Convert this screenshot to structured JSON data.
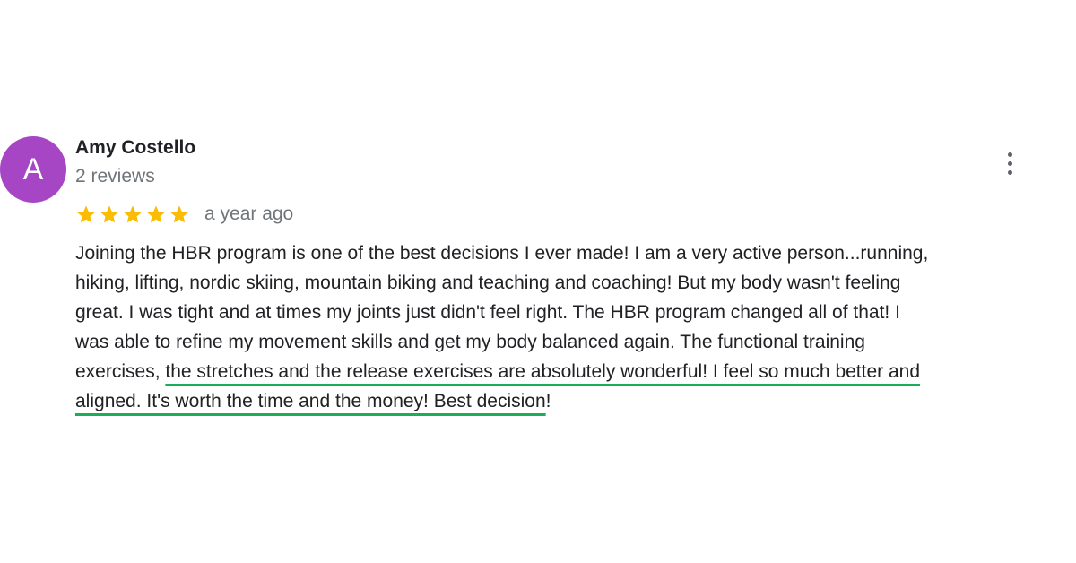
{
  "reviewer": {
    "avatar_letter": "A",
    "avatar_color": "#a646c4",
    "name": "Amy Costello",
    "review_count": "2 reviews"
  },
  "rating": {
    "stars": 5,
    "max_stars": 5,
    "star_color": "#fbbc04",
    "timestamp": "a year ago"
  },
  "menu": {
    "icon": "more-vertical-icon"
  },
  "highlight_color": "#1aae58",
  "review": {
    "lines": [
      {
        "parts": [
          {
            "text": "Joining the HBR program is one of the best decisions I ever made!  I am a very active person...running,",
            "hl": false
          }
        ]
      },
      {
        "parts": [
          {
            "text": "hiking, lifting, nordic skiing, mountain biking and teaching and coaching! But my body wasn't feeling",
            "hl": false
          }
        ]
      },
      {
        "parts": [
          {
            "text": "great.  I was tight and at times my joints just didn't feel right.  The HBR program changed all of that!  I",
            "hl": false
          }
        ]
      },
      {
        "parts": [
          {
            "text": "was able to refine my movement skills and get my body balanced again.  The functional training",
            "hl": false
          }
        ]
      },
      {
        "parts": [
          {
            "text": "exercises, ",
            "hl": false
          },
          {
            "text": "the stretches and the release exercises are absolutely wonderful! I feel so much better and",
            "hl": true
          }
        ]
      },
      {
        "parts": [
          {
            "text": "aligned.  It's worth the time and the money!  Best decision",
            "hl": true
          },
          {
            "text": "!",
            "hl": false
          }
        ]
      }
    ]
  }
}
